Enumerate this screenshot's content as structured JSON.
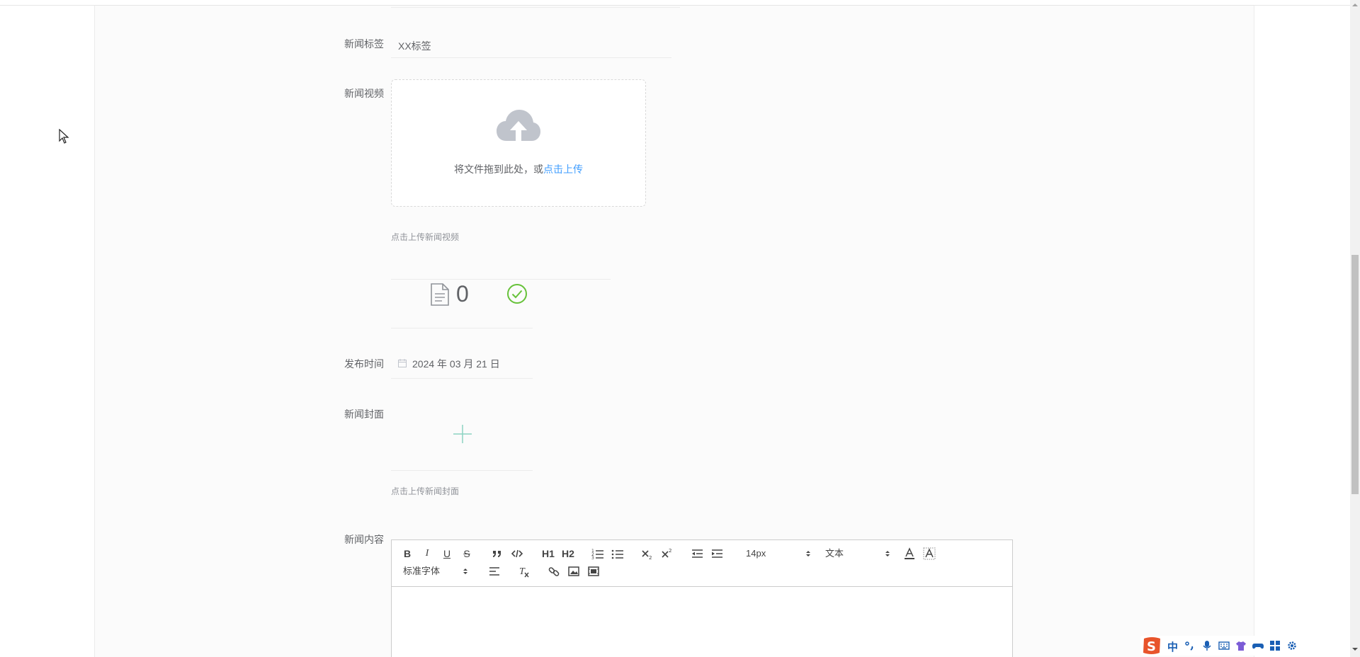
{
  "form": {
    "tag": {
      "label": "新闻标签",
      "value": "XX标签"
    },
    "video": {
      "label": "新闻视频",
      "drag_text": "将文件拖到此处，或",
      "click_upload": "点击上传",
      "tip": "点击上传新闻视频"
    },
    "stats": {
      "count": "0"
    },
    "publish_time": {
      "label": "发布时间",
      "value": "2024 年 03 月 21 日"
    },
    "cover": {
      "label": "新闻封面",
      "tip": "点击上传新闻封面"
    },
    "content": {
      "label": "新闻内容"
    }
  },
  "editor": {
    "toolbar": {
      "bold": "B",
      "italic": "I",
      "underline": "U",
      "strike": "S",
      "h1": "H1",
      "h2": "H2",
      "size_value": "14px",
      "header_value": "文本",
      "font_value": "标准字体"
    }
  },
  "ime": {
    "mode": "中"
  },
  "colors": {
    "accent": "#409eff",
    "success": "#67c23a",
    "cover_plus": "#8cd3c2"
  }
}
